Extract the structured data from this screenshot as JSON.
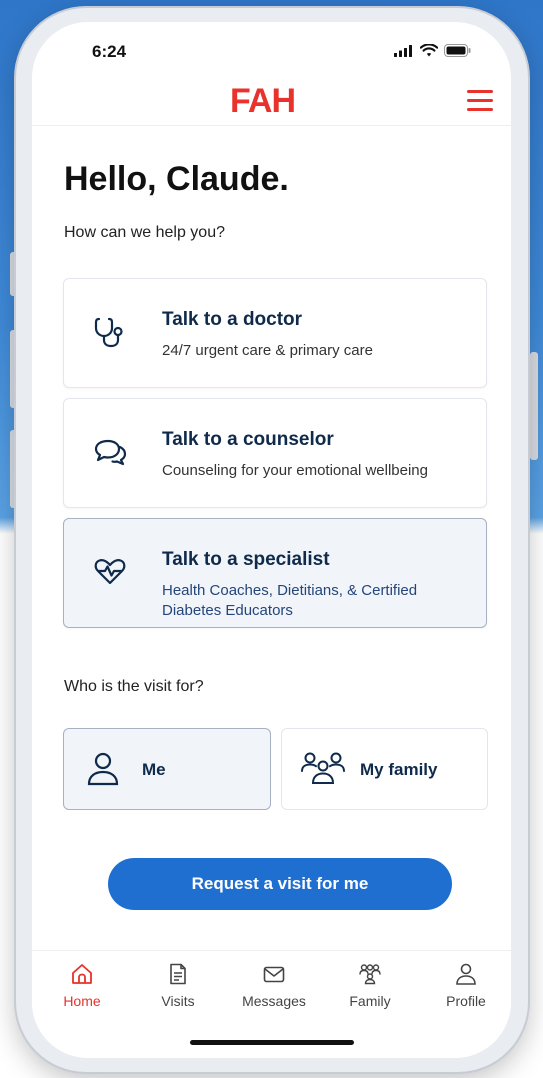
{
  "status": {
    "time": "6:24"
  },
  "header": {
    "logo": "FAH"
  },
  "greeting": "Hello, Claude.",
  "subtitle": "How can we help you?",
  "services": [
    {
      "title": "Talk to a doctor",
      "desc": "24/7 urgent care & primary care",
      "icon": "stethoscope-icon"
    },
    {
      "title": "Talk to a counselor",
      "desc": "Counseling for your emotional wellbeing",
      "icon": "chat-bubbles-icon"
    },
    {
      "title": "Talk to a specialist",
      "desc": "Health Coaches, Dietitians, & Certified Diabetes Educators",
      "icon": "heart-pulse-icon",
      "selected": true
    }
  ],
  "visit_for": {
    "label": "Who is the visit for?",
    "options": [
      {
        "label": "Me",
        "icon": "person-icon",
        "selected": true
      },
      {
        "label": "My family",
        "icon": "family-icon"
      }
    ]
  },
  "request_button": "Request a visit for me",
  "tabs": [
    {
      "label": "Home",
      "icon": "home-icon",
      "active": true
    },
    {
      "label": "Visits",
      "icon": "document-icon"
    },
    {
      "label": "Messages",
      "icon": "envelope-icon"
    },
    {
      "label": "Family",
      "icon": "family-icon"
    },
    {
      "label": "Profile",
      "icon": "person-icon"
    }
  ],
  "colors": {
    "brand_red": "#e8322b",
    "primary_blue": "#1f6fd1",
    "navy": "#0f2a4a"
  }
}
